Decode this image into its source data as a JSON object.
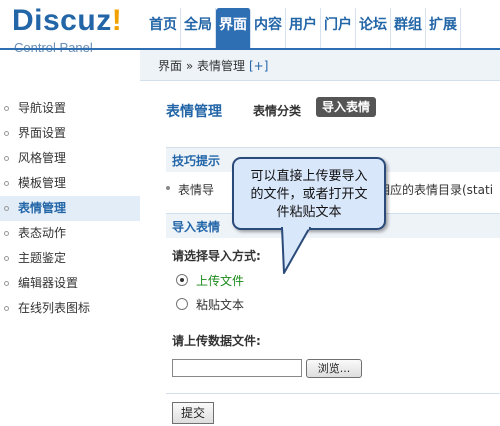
{
  "logo": {
    "main": "Discuz",
    "bang": "!",
    "sub": "Control Panel"
  },
  "nav": [
    "首页",
    "全局",
    "界面",
    "内容",
    "用户",
    "门户",
    "论坛",
    "群组",
    "扩展"
  ],
  "nav_active": "界面",
  "breadcrumb": {
    "text": "界面 » 表情管理",
    "add": "[+]"
  },
  "sidebar": {
    "items": [
      "导航设置",
      "界面设置",
      "风格管理",
      "模板管理",
      "表情管理",
      "表态动作",
      "主题鉴定",
      "编辑器设置",
      "在线列表图标"
    ],
    "active": "表情管理"
  },
  "main": {
    "title": "表情管理",
    "tab_category": "表情分类",
    "tab_import": "导入表情",
    "tips_header": "技巧提示",
    "tip_left": "表情导",
    "tip_right": "相应的表情目录(stati",
    "import_header": "导入表情",
    "method_label": "请选择导入方式:",
    "option_upload": "上传文件",
    "option_paste": "粘贴文本",
    "file_label": "请上传数据文件:",
    "browse": "浏览...",
    "submit": "提交"
  },
  "callout": {
    "line1": "可以直接上传要导入",
    "line2": "的文件，或者打开文",
    "line3": "件粘贴文本"
  }
}
